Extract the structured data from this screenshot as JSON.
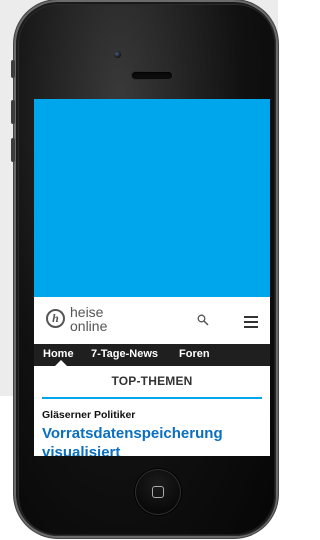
{
  "header": {
    "logo_mark": "h",
    "logo_line1": "heise",
    "logo_line2": "online"
  },
  "nav": {
    "items": [
      {
        "label": "Home"
      },
      {
        "label": "7-Tage-News"
      },
      {
        "label": "Foren"
      }
    ]
  },
  "section": {
    "title": "TOP-THEMEN"
  },
  "article": {
    "kicker": "Gläserner Politiker",
    "headline": "Vorratsdatenspeicherung visualisiert"
  },
  "colors": {
    "accent": "#00a6ec",
    "headline": "#0a6fbf",
    "navbar": "#1f1f1f"
  },
  "icons": [
    "search-icon",
    "menu-icon",
    "home-button-icon"
  ]
}
